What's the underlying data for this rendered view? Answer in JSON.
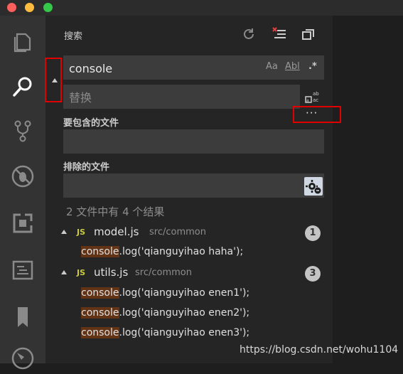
{
  "sidebar": {
    "title": "搜索",
    "search": {
      "value": "console",
      "match_case": "Aa",
      "whole_word": "Abl",
      "regex": ".*"
    },
    "replace": {
      "placeholder": "替换"
    },
    "more_options": "···",
    "include": {
      "label": "要包含的文件",
      "value": ""
    },
    "exclude": {
      "label": "排除的文件",
      "value": ""
    },
    "summary": "2 文件中有 4 个结果",
    "results": [
      {
        "file_type": "JS",
        "name": "model.js",
        "path": "src/common",
        "count": "1",
        "matches": [
          {
            "highlight": "console",
            "rest": ".log('qianguyihao haha');"
          }
        ]
      },
      {
        "file_type": "JS",
        "name": "utils.js",
        "path": "src/common",
        "count": "3",
        "matches": [
          {
            "highlight": "console",
            "rest": ".log('qianguyihao enen1');"
          },
          {
            "highlight": "console",
            "rest": ".log('qianguyihao enen2');"
          },
          {
            "highlight": "console",
            "rest": ".log('qianguyihao enen3');"
          }
        ]
      }
    ]
  },
  "activity_bar": [
    "files-icon",
    "search-icon",
    "source-control-icon",
    "debug-icon",
    "extensions-icon",
    "output-icon",
    "bookmark-icon",
    "compass-icon"
  ],
  "watermark": "https://blog.csdn.net/wohu1104",
  "colors": {
    "highlight_red": "#e00000",
    "match_bg": "#623315",
    "js_yellow": "#cbcb41"
  }
}
